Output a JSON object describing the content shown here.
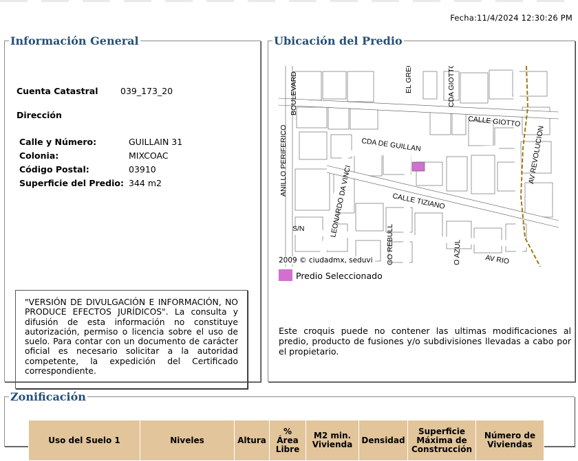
{
  "fecha": "Fecha:11/4/2024 12:30:26 PM",
  "info": {
    "legend": "Información General",
    "cuenta_label": "Cuenta Catastral",
    "cuenta_value": "039_173_20",
    "direccion_label": "Dirección",
    "fields": [
      {
        "label": "Calle y Número:",
        "value": "GUILLAIN 31"
      },
      {
        "label": "Colonia:",
        "value": "MIXCOAC"
      },
      {
        "label": "Código Postal:",
        "value": "03910"
      },
      {
        "label": "Superficie del Predio:",
        "value": "344 m2"
      }
    ],
    "disclaimer": "\"VERSIÓN DE DIVULGACIÓN E INFORMACIÓN, NO PRODUCE EFECTOS JURÍDICOS\". La consulta y difusión de esta información no constituye autorización, permiso o licencia sobre el uso de suelo. Para contar con un documento de carácter oficial es necesario solicitar a la autoridad competente, la expedición del Certificado correspondiente."
  },
  "ubicacion": {
    "legend": "Ubicación del Predio",
    "streets": [
      "BOULEVARD",
      "ANILLO PERIFERICO",
      "EL GRECO",
      "CDA GIOTTO",
      "CALLE GIOTTO",
      "CDA DE GUILLAN",
      "AV REVOLUCION",
      "LEONARDO DA VINCI",
      "CALLE TIZIANO",
      "S/N",
      "GO REBULL",
      "O AZUL",
      "AV RIO"
    ],
    "credit": "2009 © ciudadmx, seduvi",
    "selected_legend": "Predio Seleccionado",
    "selected_color": "#d070cf",
    "note": "Este croquis puede no contener las ultimas modificaciones al predio, producto de fusiones y/o subdivisiones llevadas a cabo por el propietario."
  },
  "zonificacion": {
    "legend": "Zonificación",
    "headers": [
      "Uso del Suelo 1",
      "Niveles",
      "Altura",
      "% Área Libre",
      "M2 min. Vivienda",
      "Densidad",
      "Superficie Máxima de Construcción",
      "Número de Viviendas"
    ],
    "header_color": "#e2c59b"
  }
}
